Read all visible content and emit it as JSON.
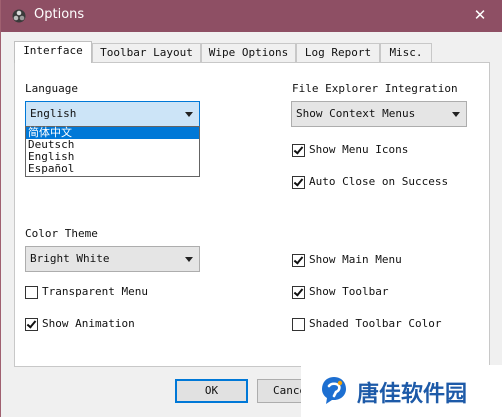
{
  "window": {
    "title": "Options",
    "close_glyph": "✕",
    "icon": "app-icon",
    "accent": "#8e4f64"
  },
  "tabs": [
    {
      "label": "Interface",
      "active": true
    },
    {
      "label": "Toolbar Layout",
      "active": false
    },
    {
      "label": "Wipe Options",
      "active": false
    },
    {
      "label": "Log Report",
      "active": false
    },
    {
      "label": "Misc.",
      "active": false
    }
  ],
  "interface": {
    "language": {
      "label": "Language",
      "value": "English",
      "options": [
        "简体中文",
        "Deutsch",
        "English",
        "Español"
      ],
      "highlighted": "简体中文"
    },
    "explorer": {
      "label": "File Explorer Integration",
      "value": "Show Context Menus"
    },
    "show_menu_icons": {
      "label": "Show Menu Icons",
      "checked": true
    },
    "auto_close": {
      "label": "Auto Close on Success",
      "checked": true
    },
    "color_theme": {
      "label": "Color Theme",
      "value": "Bright White"
    },
    "show_main_menu": {
      "label": "Show Main Menu",
      "checked": true
    },
    "transparent_menu": {
      "label": "Transparent Menu",
      "checked": false
    },
    "show_toolbar": {
      "label": "Show Toolbar",
      "checked": true
    },
    "show_animation": {
      "label": "Show Animation",
      "checked": true
    },
    "shaded_toolbar": {
      "label": "Shaded Toolbar Color",
      "checked": false
    }
  },
  "buttons": {
    "ok": "OK",
    "cancel": "Cance"
  },
  "watermark": {
    "text": "唐佳软件园",
    "color": "#1d5aa8"
  }
}
